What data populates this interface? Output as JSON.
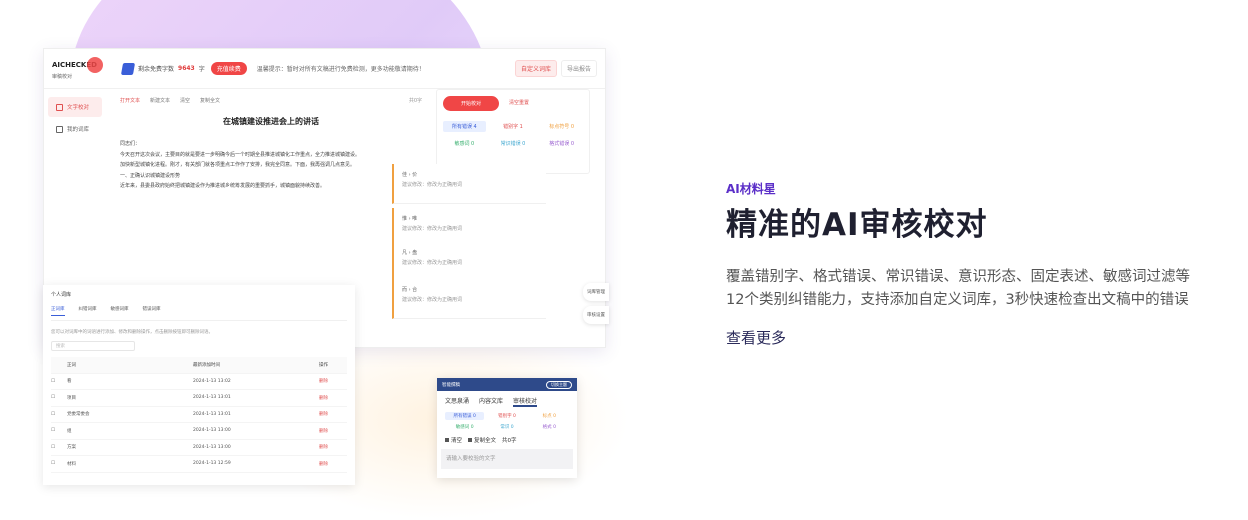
{
  "topbar": {
    "logo": "AICHECKED",
    "logo_sub": "审稿校对",
    "wordcount_label": "剩余免费字数",
    "wordcount_value": "9643",
    "wordcount_unit": "字",
    "buy_btn": "充值续费",
    "tip": "温馨提示：暂时对所有文稿进行免费检测，更多功能敬请期待！",
    "btn_custom": "自定义词库",
    "btn_export": "导出报告"
  },
  "sidebar": {
    "items": [
      {
        "label": "文字校对"
      },
      {
        "label": "我的词库"
      }
    ]
  },
  "editor": {
    "tools": [
      "打开文本",
      "新建文本",
      "清空",
      "复制全文"
    ],
    "count": "共0字",
    "title": "在城镇建设推进会上的讲话",
    "paragraphs": [
      "同志们：",
      "今天召开这次会议，主要目的就是要进一步明确今后一个时期全县推进城镇化工作重点，全力推进城镇建设。",
      "加快新型城镇化进程。刚才，有关部门就各项重点工作作了安排，我完全同意。下面，我再强调几点意见。",
      "一、正确认识城镇建设形势",
      "近年来，县委县政府始终把城镇建设作为推进城乡统筹发展的重要抓手，城镇面貌持续改善。"
    ]
  },
  "panel": {
    "start_btn": "开始校对",
    "alt": "清空重置",
    "categories": [
      "所有错误 4",
      "错别字 1",
      "标点符号 0",
      "敏感词 0",
      "常识错误 0",
      "格式错误 0"
    ]
  },
  "errors": [
    {
      "pair": "佳  ›  价",
      "sub": "建议修改：修改为正确用词"
    },
    {
      "pair": "惟  ›  唯",
      "sub": "建议修改：修改为正确用词"
    },
    {
      "pair": "凡  ›  盘",
      "sub": "建议修改：修改为正确用词"
    },
    {
      "pair": "而  ›  合",
      "sub": "建议修改：修改为正确用词"
    }
  ],
  "side_tabs": [
    "词库管理",
    "审核设置"
  ],
  "library": {
    "title": "个人词库",
    "tabs": [
      "正词库",
      "纠错词库",
      "敏感词库",
      "错误词库"
    ],
    "note": "您可以对词库中的词语进行添加、修改和删除操作，点击删除按钮即可删除词语。",
    "search_placeholder": "搜索",
    "headers": [
      "",
      "正词",
      "最新添加时间",
      "操作"
    ],
    "rows": [
      {
        "word": "看",
        "time": "2024-1-13 13:02",
        "op": "删除"
      },
      {
        "word": "项目",
        "time": "2024-1-13 13:01",
        "op": "删除"
      },
      {
        "word": "党委常委会",
        "time": "2024-1-13 13:01",
        "op": "删除"
      },
      {
        "word": "组",
        "time": "2024-1-13 13:00",
        "op": "删除"
      },
      {
        "word": "方案",
        "time": "2024-1-13 13:00",
        "op": "删除"
      },
      {
        "word": "材料",
        "time": "2024-1-13 12:59",
        "op": "删除"
      }
    ]
  },
  "mini": {
    "head": "智能撰稿",
    "pill": "切换主题",
    "tabs": [
      "文思泉涌",
      "内容文库",
      "审核校对"
    ],
    "categories": [
      "所有错误 0",
      "错别字 0",
      "标点 0",
      "敏感词 0",
      "常识 0",
      "格式 0"
    ],
    "clear": "清空",
    "copy": "复制全文",
    "count": "共0字",
    "placeholder": "请输入要校验的文字"
  },
  "feature": {
    "brand": "AI材料星",
    "headline": "精准的AI审核校对",
    "description": "覆盖错别字、格式错误、常识错误、意识形态、固定表述、敏感词过滤等12个类别纠错能力，支持添加自定义词库，3秒快速检查出文稿中的错误",
    "link": "查看更多"
  }
}
